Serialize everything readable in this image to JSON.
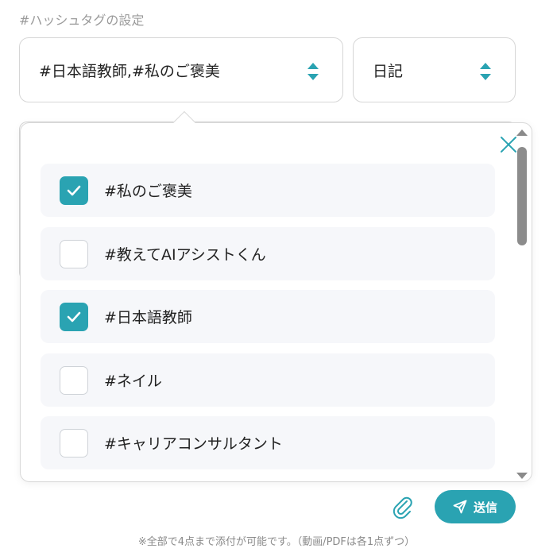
{
  "hashtag_section": {
    "label": "#ハッシュタグの設定"
  },
  "tag_select": {
    "value": "#日本語教師,#私のご褒美"
  },
  "category_select": {
    "value": "日記"
  },
  "tag_list": {
    "items": [
      {
        "label": "#私のご褒美",
        "checked": true
      },
      {
        "label": "#教えてAIアシストくん",
        "checked": false
      },
      {
        "label": "#日本語教師",
        "checked": true
      },
      {
        "label": "#ネイル",
        "checked": false
      },
      {
        "label": "#キャリアコンサルタント",
        "checked": false
      }
    ]
  },
  "actions": {
    "send_label": "送信"
  },
  "footnote": "※全部で4点まで添付が可能です。（動画/PDFは各1点ずつ）",
  "colors": {
    "accent": "#2aa3b2"
  },
  "icons": {
    "close": "close-icon",
    "check": "check-icon",
    "attach": "paperclip-icon",
    "send": "paper-plane-icon",
    "select": "sort-arrows-icon"
  }
}
